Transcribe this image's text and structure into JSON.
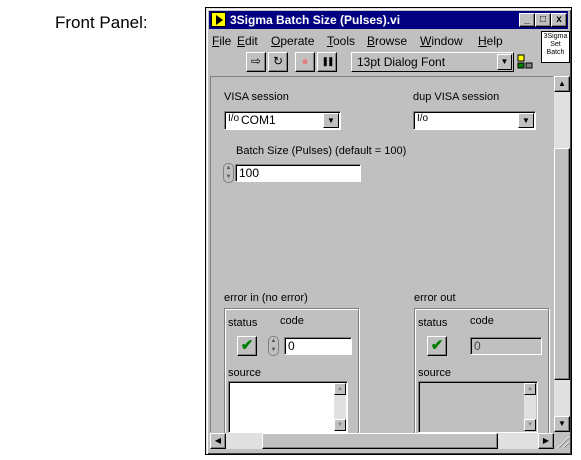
{
  "caption": "Front Panel:",
  "window": {
    "title": "3Sigma Batch Size (Pulses).vi",
    "buttons": {
      "minimize": "_",
      "maximize": "□",
      "close": "x"
    }
  },
  "menu": [
    "File",
    "Edit",
    "Operate",
    "Tools",
    "Browse",
    "Window",
    "Help"
  ],
  "vi_icon": {
    "line1": "3Sigma",
    "line2": "Set",
    "line3": "Batch"
  },
  "toolbar": {
    "run_glyph": "⇨",
    "run_continuous_glyph": "↻",
    "abort_glyph": "●",
    "pause_glyph": "❚❚",
    "font": "13pt Dialog Font",
    "dropdown_glyph": "▼"
  },
  "controls": {
    "visa_session": {
      "label": "VISA session",
      "icon": "I/o",
      "value": "COM1"
    },
    "dup_visa_session": {
      "label": "dup VISA session",
      "icon": "I/o",
      "value": ""
    },
    "batch_size": {
      "label": "Batch Size (Pulses) (default = 100)",
      "value": "100"
    }
  },
  "error_in": {
    "label": "error in (no error)",
    "status_label": "status",
    "status_glyph": "✔",
    "code_label": "code",
    "code_value": "0",
    "source_label": "source"
  },
  "error_out": {
    "label": "error out",
    "status_label": "status",
    "status_glyph": "✔",
    "code_label": "code",
    "code_value": "0",
    "source_label": "source"
  },
  "colors": {
    "titlebar": "#000080",
    "panel": "#c0c0c0",
    "status_ok": "#008000"
  }
}
